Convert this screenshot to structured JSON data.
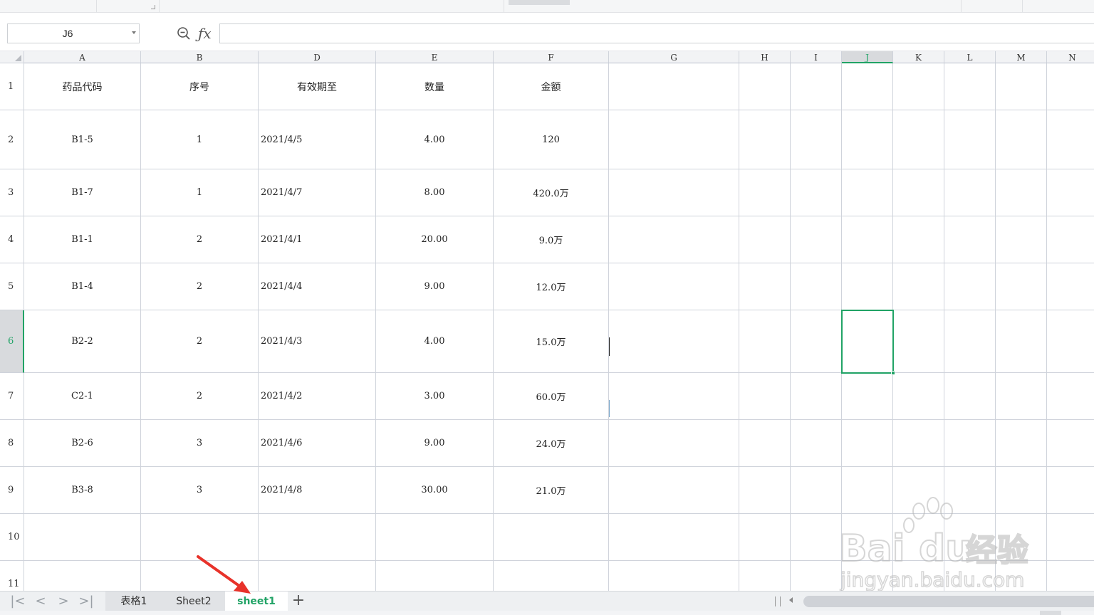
{
  "formula_bar": {
    "name_box": "J6",
    "formula": "",
    "icons": [
      "zoom-icon",
      "fx-icon"
    ]
  },
  "columns": [
    "A",
    "B",
    "D",
    "E",
    "F",
    "G",
    "H",
    "I",
    "J",
    "K",
    "L",
    "M",
    "N"
  ],
  "selected_column": "J",
  "rows": [
    "1",
    "2",
    "3",
    "4",
    "5",
    "6",
    "7",
    "8",
    "9",
    "10",
    "11"
  ],
  "selected_row": "6",
  "table": {
    "headers": [
      "药品代码",
      "序号",
      "有效期至",
      "数量",
      "金额"
    ],
    "rows": [
      [
        "B1-5",
        "1",
        "2021/4/5",
        "4.00",
        "120"
      ],
      [
        "B1-7",
        "1",
        "2021/4/7",
        "8.00",
        "420.0万"
      ],
      [
        "B1-1",
        "2",
        "2021/4/1",
        "20.00",
        "9.0万"
      ],
      [
        "B1-4",
        "2",
        "2021/4/4",
        "9.00",
        "12.0万"
      ],
      [
        "B2-2",
        "2",
        "2021/4/3",
        "4.00",
        "15.0万"
      ],
      [
        "C2-1",
        "2",
        "2021/4/2",
        "3.00",
        "60.0万"
      ],
      [
        "B2-6",
        "3",
        "2021/4/6",
        "9.00",
        "24.0万"
      ],
      [
        "B3-8",
        "3",
        "2021/4/8",
        "30.00",
        "21.0万"
      ]
    ]
  },
  "sheet_tabs": [
    {
      "label": "表格1",
      "active": false
    },
    {
      "label": "Sheet2",
      "active": false
    },
    {
      "label": "sheet1",
      "active": true
    }
  ],
  "tab_nav": {
    "first": "|<",
    "prev": "<",
    "next": ">",
    "last": ">|",
    "add": "+"
  },
  "watermark": {
    "brand": "Bai",
    "brand2": "du",
    "cn": "经验",
    "url": "jingyan.baidu.com"
  },
  "colors": {
    "accent": "#21a366",
    "annotation_arrow": "#e8322a",
    "grid": "#cfd3db"
  }
}
